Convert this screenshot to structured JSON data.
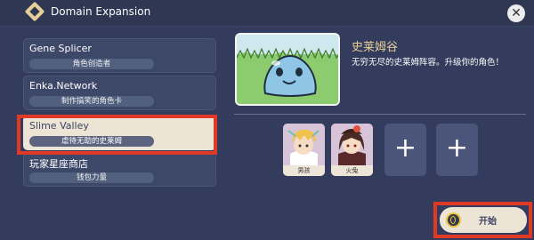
{
  "window": {
    "title": "Domain Expansion",
    "close_icon": "close-icon",
    "title_icon": "diamond-icon"
  },
  "sidebar": {
    "items": [
      {
        "name": "Gene Splicer",
        "tag": "角色创造者",
        "active": false
      },
      {
        "name": "Enka.Network",
        "tag": "制作搞笑的角色卡",
        "active": false
      },
      {
        "name": "Slime Valley",
        "tag": "虐待无助的史莱姆",
        "active": true
      },
      {
        "name": "玩家星座商店",
        "tag": "钱包力量",
        "active": false
      }
    ]
  },
  "detail": {
    "title": "史莱姆谷",
    "description": "无穷无尽的史莱姆阵容。升级你的角色！",
    "preview_icon": "slime-illustration"
  },
  "party": {
    "slots": [
      {
        "label": "男孩",
        "filled": true,
        "icon": "boy-character-portrait"
      },
      {
        "label": "火兔",
        "filled": true,
        "icon": "fire-rabbit-character-portrait"
      },
      {
        "label": "+",
        "filled": false,
        "icon": "plus-icon"
      },
      {
        "label": "+",
        "filled": false,
        "icon": "plus-icon"
      }
    ]
  },
  "footer": {
    "start_label": "开始",
    "start_icon": "primogem-icon"
  },
  "colors": {
    "accent": "#e7cf9a",
    "highlight": "#e03a26",
    "panel": "#333c5c",
    "active_item": "#ece5d5"
  }
}
